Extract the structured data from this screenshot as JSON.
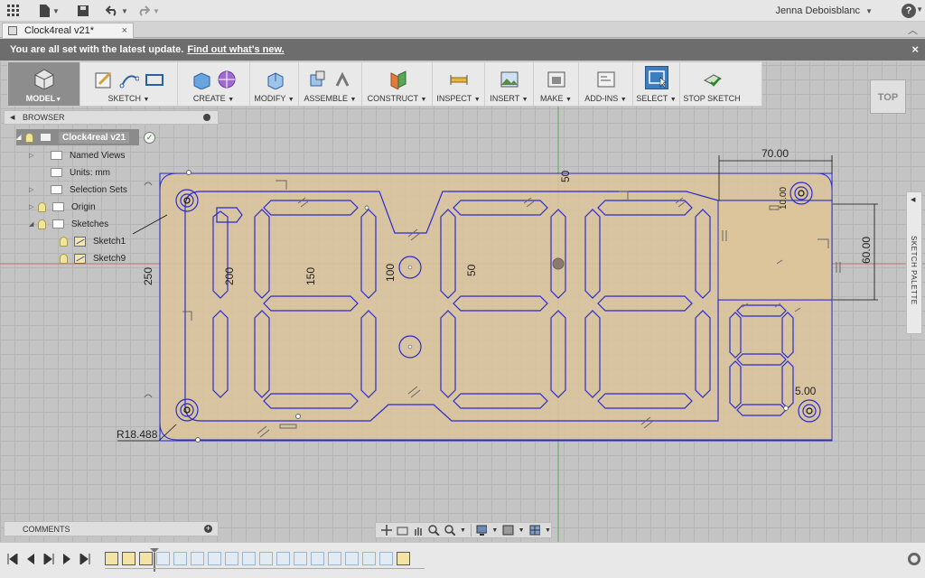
{
  "appbar": {
    "user_name": "Jenna Deboisblanc",
    "help_label": "?",
    "icons": [
      "grid-icon",
      "file-icon",
      "save-icon",
      "undo-icon",
      "redo-icon"
    ]
  },
  "tabs": {
    "document_title": "Clock4real v21*",
    "close_label": "×",
    "collapse_label": "︿"
  },
  "notification": {
    "text": "You are all set with the latest update.",
    "link": "Find out what's new.",
    "close_label": "×"
  },
  "toolbar": {
    "model_label": "MODEL",
    "groups": [
      {
        "label": "SKETCH"
      },
      {
        "label": "CREATE"
      },
      {
        "label": "MODIFY"
      },
      {
        "label": "ASSEMBLE"
      },
      {
        "label": "CONSTRUCT"
      },
      {
        "label": "INSPECT"
      },
      {
        "label": "INSERT"
      },
      {
        "label": "MAKE"
      },
      {
        "label": "ADD-INS"
      },
      {
        "label": "SELECT"
      },
      {
        "label": "STOP SKETCH"
      }
    ]
  },
  "view_cube": {
    "label": "TOP"
  },
  "browser": {
    "title": "BROWSER",
    "root": "Clock4real v21",
    "items": [
      {
        "label": "Named Views"
      },
      {
        "label": "Units: mm"
      },
      {
        "label": "Selection Sets"
      },
      {
        "label": "Origin"
      },
      {
        "label": "Sketches"
      },
      {
        "label": "Sketch1"
      },
      {
        "label": "Sketch9"
      }
    ]
  },
  "comments": {
    "title": "COMMENTS"
  },
  "sketch_palette": {
    "title": "SKETCH PALETTE"
  },
  "dimensions": {
    "d70": "70.00",
    "d60": "60.00",
    "d50": "50",
    "d250": "250",
    "d200": "200",
    "d150": "150",
    "d100": "100",
    "d50b": "50",
    "radius": "R18.488",
    "d5": "5.00",
    "d10": "10.00"
  },
  "colors": {
    "body": "#dcc49b",
    "sketch_line": "#2b2bcc",
    "grid": "#b5b5b5",
    "select_active": "#3c7fc0"
  }
}
